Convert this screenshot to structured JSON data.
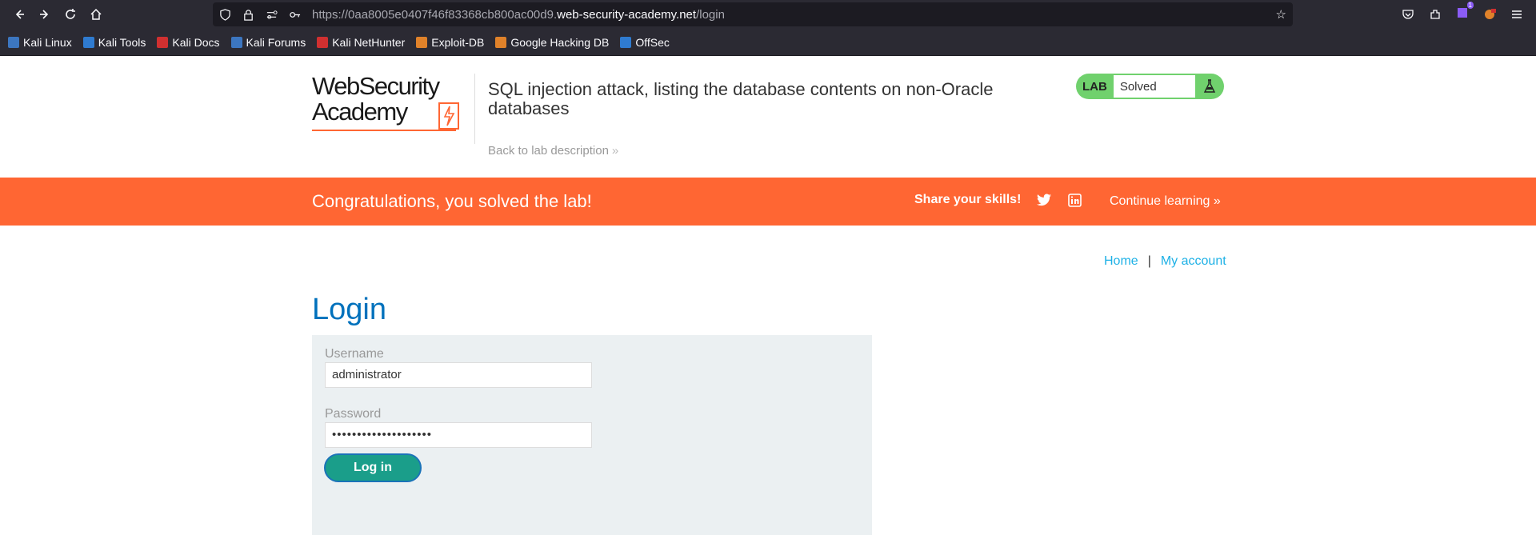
{
  "browser": {
    "url_prefix": "https://0aa8005e0407f46f83368cb800ac00d9.",
    "url_host": "web-security-academy.net",
    "url_path": "/login",
    "ext_badge": "1"
  },
  "bookmarks": [
    {
      "label": "Kali Linux",
      "color": "#3c76c0"
    },
    {
      "label": "Kali Tools",
      "color": "#2f7bd0"
    },
    {
      "label": "Kali Docs",
      "color": "#d03030"
    },
    {
      "label": "Kali Forums",
      "color": "#3c76c0"
    },
    {
      "label": "Kali NetHunter",
      "color": "#d03030"
    },
    {
      "label": "Exploit-DB",
      "color": "#e0822a"
    },
    {
      "label": "Google Hacking DB",
      "color": "#e0822a"
    },
    {
      "label": "OffSec",
      "color": "#2f7bd0"
    }
  ],
  "header": {
    "logo_line1": "WebSecurity",
    "logo_line2": "Academy",
    "lab_title": "SQL injection attack, listing the database contents on non-Oracle databases",
    "back_link": "Back to lab description",
    "lab_tag": "LAB",
    "lab_state": "Solved"
  },
  "banner": {
    "message": "Congratulations, you solved the lab!",
    "share": "Share your skills!",
    "continue": "Continue learning"
  },
  "nav": {
    "home": "Home",
    "separator": "|",
    "account": "My account"
  },
  "login": {
    "title": "Login",
    "username_label": "Username",
    "username_value": "administrator",
    "password_label": "Password",
    "password_value": "••••••••••••••••••••",
    "submit": "Log in"
  },
  "colors": {
    "accent": "#ff6633",
    "link": "#1eb1e6",
    "title_blue": "#0071bc",
    "button": "#1a9e8a",
    "lab_green": "#70d16d"
  }
}
